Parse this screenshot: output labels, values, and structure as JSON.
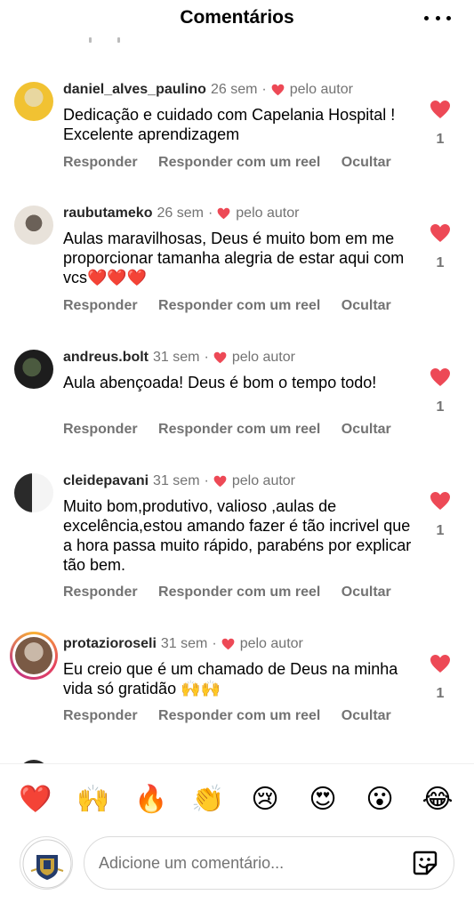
{
  "header": {
    "title": "Comentários"
  },
  "comments": [
    {
      "username": "daniel_alves_paulino",
      "time": "26 sem",
      "dot": "·",
      "author_label": "pelo autor",
      "text": "Dedicação e cuidado com Capelania Hospital ! Excelente aprendizagem",
      "likes": "1",
      "avatar_colors": [
        "#f1c232",
        "#e8d7a0"
      ]
    },
    {
      "username": "raubutameko",
      "time": "26 sem",
      "dot": "·",
      "author_label": "pelo autor",
      "text": "Aulas maravilhosas, Deus é muito bom em me proporcionar tamanha alegria de estar aqui com vcs❤️❤️❤️",
      "likes": "1",
      "avatar_colors": [
        "#e8e2da",
        "#6b6158"
      ]
    },
    {
      "username": "andreus.bolt",
      "time": "31 sem",
      "dot": "·",
      "author_label": "pelo autor",
      "text": "Aula abençoada! Deus é bom o tempo todo!",
      "likes": "1",
      "avatar_colors": [
        "#1d1d1d",
        "#4b5a3f"
      ]
    },
    {
      "username": "cleidepavani",
      "time": "31 sem",
      "dot": "·",
      "author_label": "pelo autor",
      "text": "Muito bom,produtivo, valioso ,aulas de excelência,estou amando fazer é tão incrivel que a hora passa muito rápido, parabéns por explicar tão bem.",
      "likes": "1",
      "avatar_colors": [
        "#f4f4f4",
        "#2a2a2a"
      ]
    },
    {
      "username": "protazioroseli",
      "time": "31 sem",
      "dot": "·",
      "author_label": "pelo autor",
      "text": "Eu creio que é um chamado de Deus na minha vida só gratidão 🙌🙌",
      "likes": "1",
      "avatar_colors": [
        "#c9b8a8",
        "#7a5a45"
      ]
    }
  ],
  "actions": {
    "reply": "Responder",
    "reply_reel": "Responder com um reel",
    "hide": "Ocultar"
  },
  "emojis": [
    "❤️",
    "🙌",
    "🔥",
    "👏",
    "😢",
    "😍",
    "😮",
    "😂"
  ],
  "composer": {
    "placeholder": "Adicione um comentário..."
  },
  "colors": {
    "like_red": "#ed4956",
    "muted": "#737373"
  },
  "icons": {
    "more": "more-icon",
    "heart": "heart-icon",
    "sticker": "sticker-icon"
  }
}
